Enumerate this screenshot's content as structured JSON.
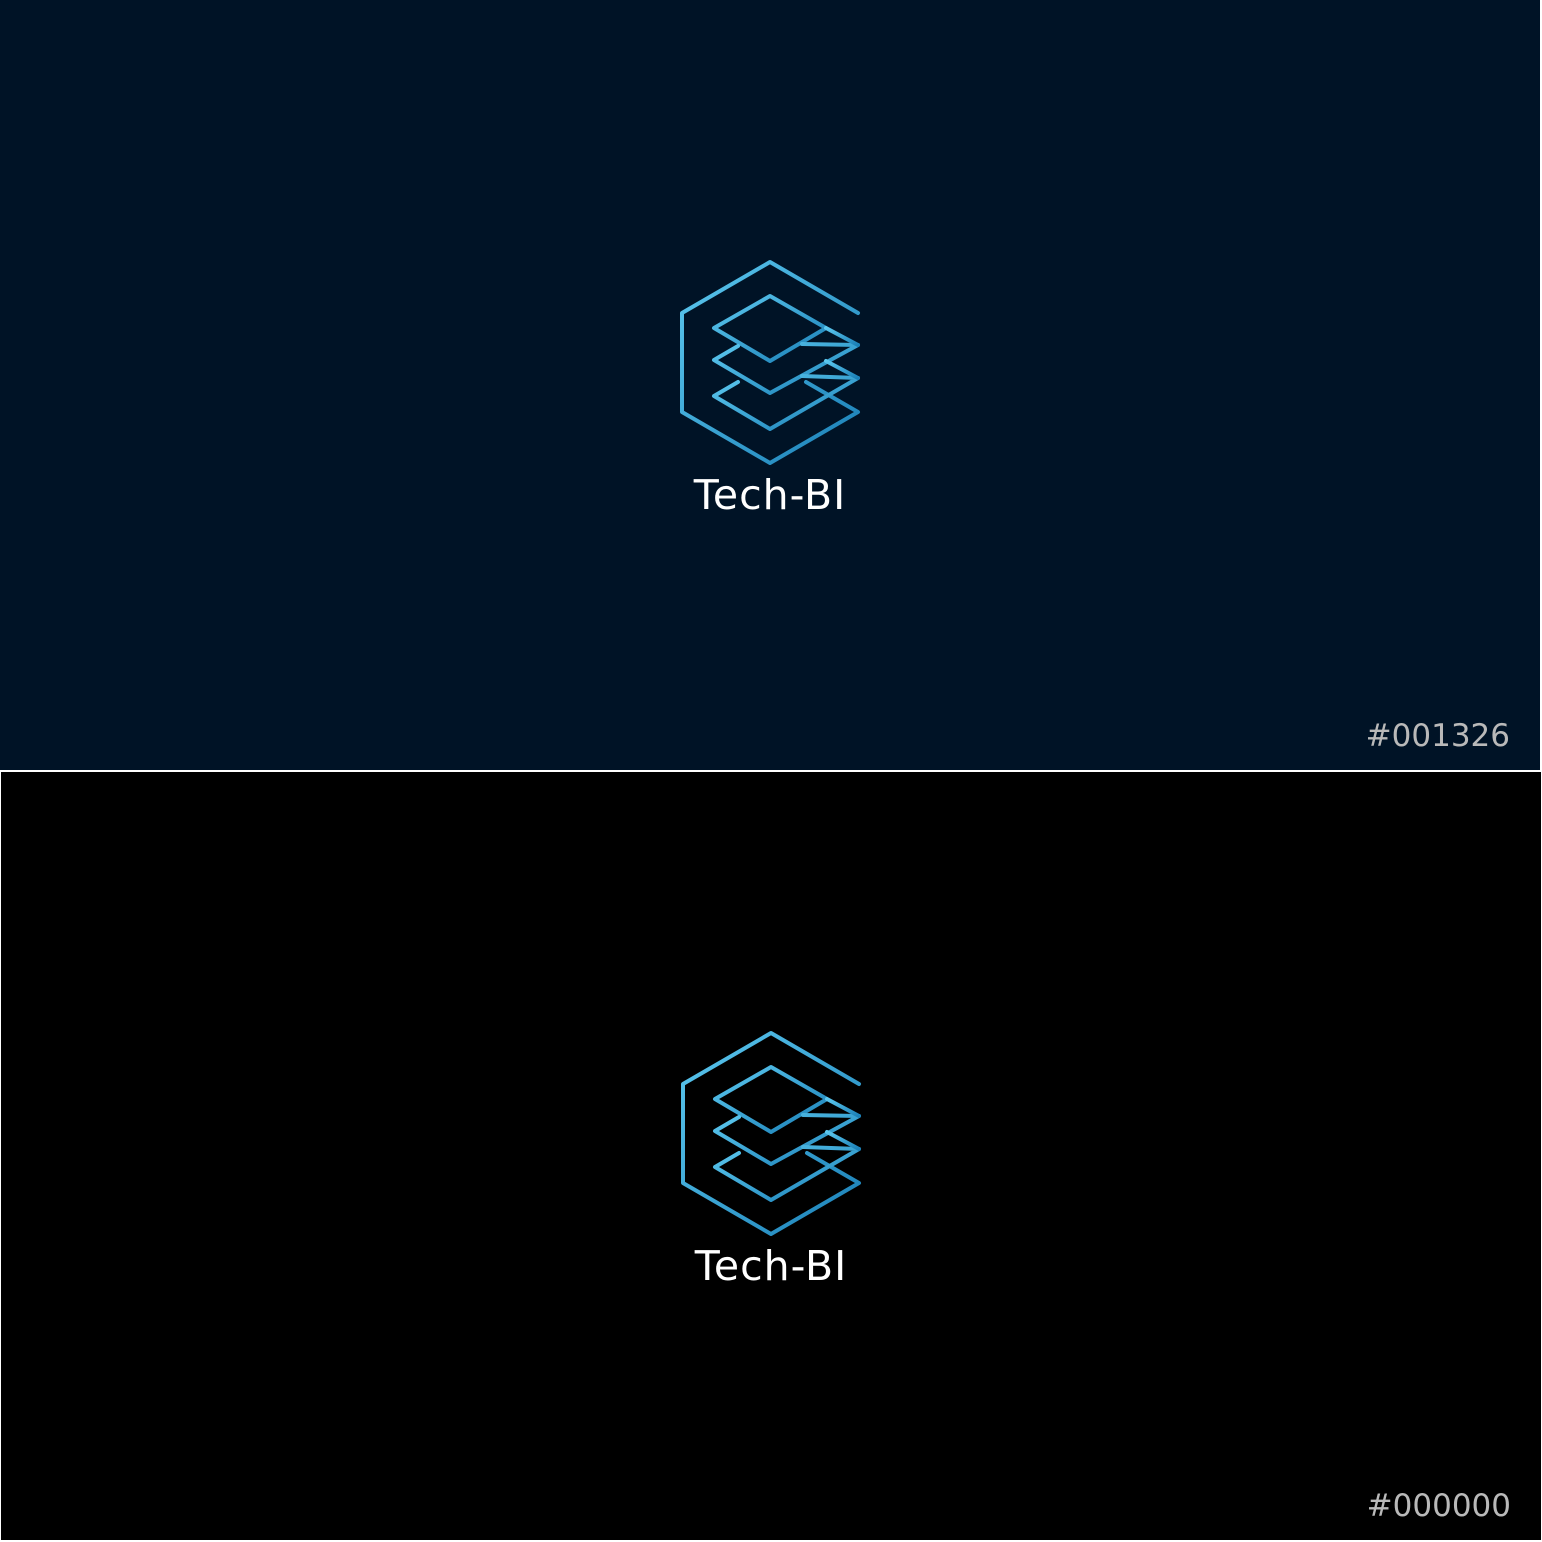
{
  "brand": {
    "name": "Tech-BI",
    "logo_gradient": [
      "#5cc8ef",
      "#1a7fb6"
    ]
  },
  "panels": [
    {
      "background": "#001326",
      "swatch_label": "#001326"
    },
    {
      "background": "#000000",
      "swatch_label": "#000000"
    }
  ]
}
